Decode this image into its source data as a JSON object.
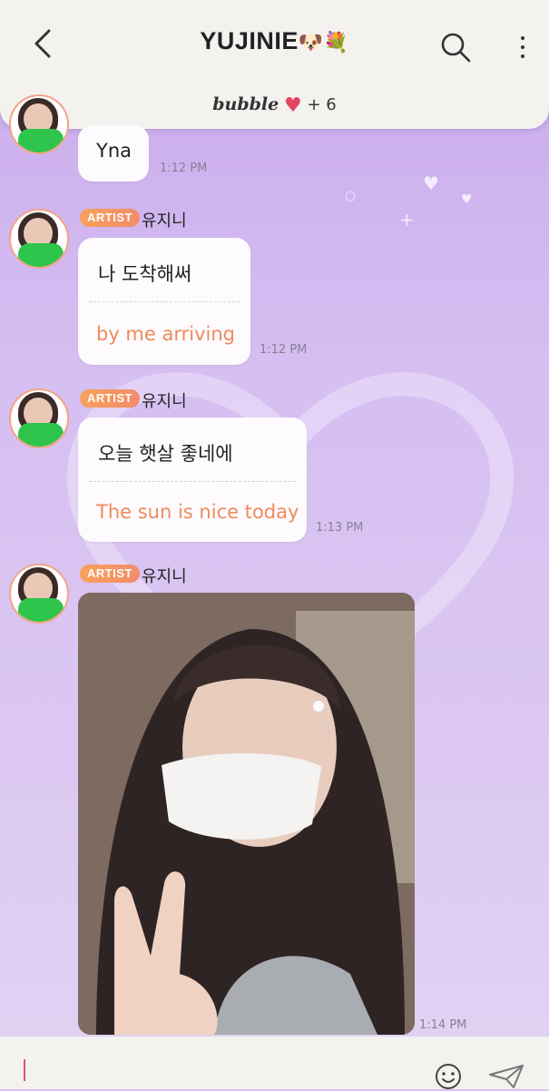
{
  "header": {
    "title": "YUJINIE",
    "title_emoji": "🐶💐",
    "subscription_brand": "bubble",
    "subscription_extra": "+ 6",
    "back_icon": "chevron-left-icon",
    "search_icon": "search-icon",
    "more_icon": "more-vertical-icon"
  },
  "messages": [
    {
      "text": "Yna",
      "time": "1:12 PM"
    },
    {
      "badge": "ARTIST",
      "sender": "유지니",
      "text": "나 도착해써",
      "translation": "by me arriving",
      "time": "1:12 PM"
    },
    {
      "badge": "ARTIST",
      "sender": "유지니",
      "text": "오늘 햇살 좋네에",
      "translation": "The sun is nice today",
      "time": "1:13 PM"
    },
    {
      "badge": "ARTIST",
      "sender": "유지니",
      "type": "photo",
      "time": "1:14 PM"
    }
  ],
  "composer": {
    "emoji_icon": "smiley-icon",
    "send_icon": "paper-plane-icon"
  },
  "colors": {
    "accent": "#f08a5c",
    "badge": "#f7a15b",
    "background": "#d6bff1",
    "heart": "#e2465e"
  }
}
